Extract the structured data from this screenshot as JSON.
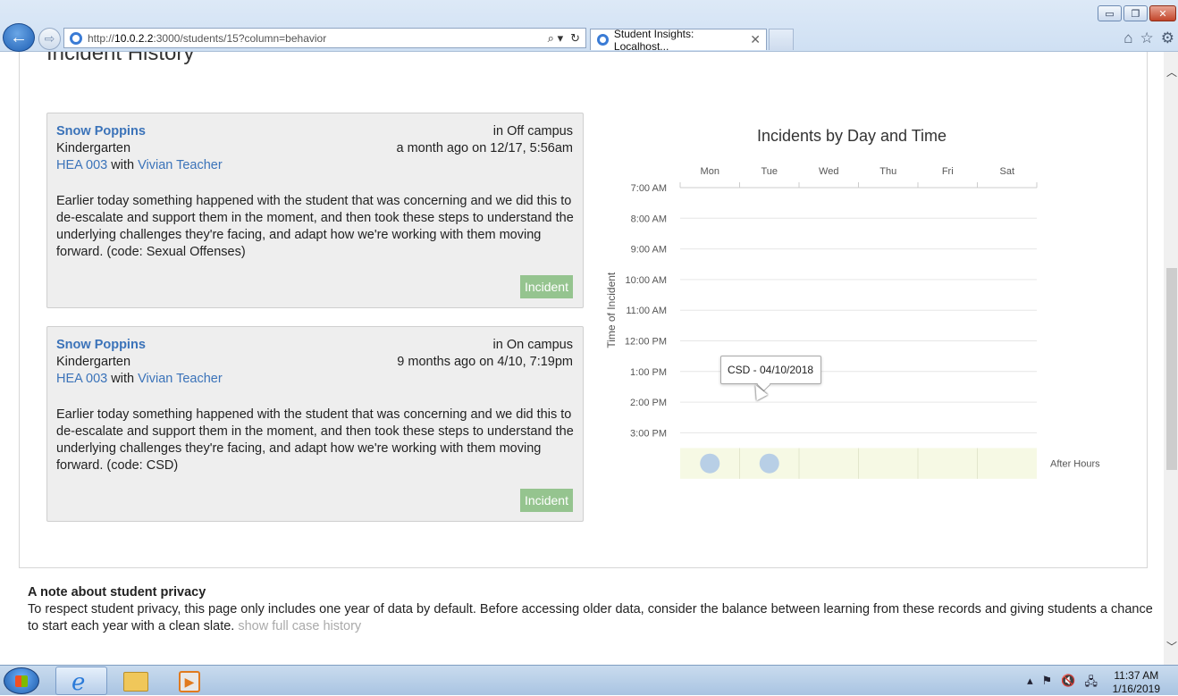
{
  "browser": {
    "url_prefix": "http://",
    "url_host": "10.0.2.2",
    "url_rest": ":3000/students/15?column=behavior",
    "tab_title": "Student Insights: Localhost...",
    "tab_close": "✕",
    "search_glyph": "⌕ ▾",
    "refresh_glyph": "↻"
  },
  "window_controls": {
    "minimize": "▭",
    "maximize": "❐",
    "close": "✕"
  },
  "page": {
    "section_title": "Incident History"
  },
  "incidents": [
    {
      "student": "Snow Poppins",
      "grade": "Kindergarten",
      "homeroom": "HEA 003",
      "with": "with",
      "teacher": "Vivian Teacher",
      "location": "in Off campus",
      "when": "a month ago on 12/17, 5:56am",
      "body": "Earlier today something happened with the student that was concerning and we did this to de-escalate and support them in the moment, and then took these steps to understand the underlying challenges they're facing, and adapt how we're working with them moving forward. (code: Sexual Offenses)",
      "badge": "Incident"
    },
    {
      "student": "Snow Poppins",
      "grade": "Kindergarten",
      "homeroom": "HEA 003",
      "with": "with",
      "teacher": "Vivian Teacher",
      "location": "in On campus",
      "when": "9 months ago on 4/10, 7:19pm",
      "body": "Earlier today something happened with the student that was concerning and we did this to de-escalate and support them in the moment, and then took these steps to understand the underlying challenges they're facing, and adapt how we're working with them moving forward. (code: CSD)",
      "badge": "Incident"
    }
  ],
  "chart_data": {
    "type": "scatter",
    "title": "Incidents by Day and Time",
    "ylabel": "Time of Incident",
    "x_categories": [
      "Mon",
      "Tue",
      "Wed",
      "Thu",
      "Fri",
      "Sat"
    ],
    "y_categories": [
      "7:00 AM",
      "8:00 AM",
      "9:00 AM",
      "10:00 AM",
      "11:00 AM",
      "12:00 PM",
      "1:00 PM",
      "2:00 PM",
      "3:00 PM"
    ],
    "after_hours_label": "After Hours",
    "points": [
      {
        "day": "Mon",
        "time": "After Hours"
      },
      {
        "day": "Tue",
        "time": "After Hours"
      }
    ],
    "tooltip": "CSD - 04/10/2018",
    "colors": {
      "point": "#a9c4e6",
      "after_hours_band": "#f6f9e4",
      "grid": "#e6e6e6"
    }
  },
  "privacy": {
    "title": "A note about student privacy",
    "text": "To respect student privacy, this page only includes one year of data by default. Before accessing older data, consider the balance between learning from these records and giving students a chance to start each year with a clean slate.",
    "link": "show full case history"
  },
  "taskbar": {
    "time": "11:37 AM",
    "date": "1/16/2019"
  }
}
